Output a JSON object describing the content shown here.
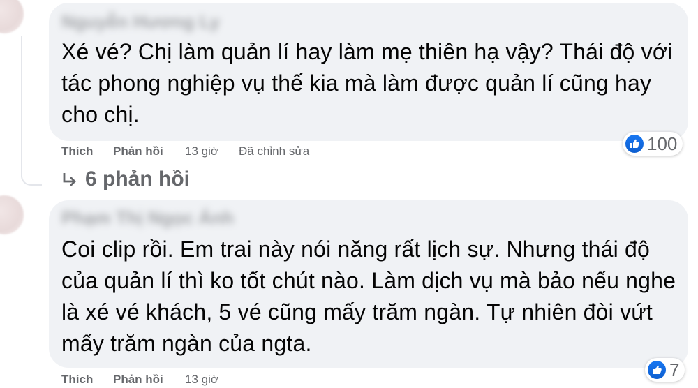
{
  "comments": [
    {
      "author": "Nguyễn Hương Ly",
      "text": "Xé vé? Chị làm quản lí hay làm mẹ thiên hạ vậy? Thái độ với tác phong nghiệp vụ thế kia mà làm được quản lí cũng hay cho chị.",
      "like_label": "Thích",
      "reply_label": "Phản hồi",
      "time": "13 giờ",
      "edited": "Đã chỉnh sửa",
      "reaction_icon": "like-icon",
      "reaction_count": "100",
      "replies_label": "6 phản hồi"
    },
    {
      "author": "Phạm Thị Ngọc Ánh",
      "text": "Coi clip rồi. Em trai này nói năng rất lịch sự. Nhưng thái độ của quản lí thì ko tốt chút nào. Làm dịch vụ mà bảo nếu nghe là xé vé khách, 5 vé cũng mấy trăm ngàn. Tự nhiên đòi vứt mấy trăm ngàn của ngta.",
      "like_label": "Thích",
      "reply_label": "Phản hồi",
      "time": "13 giờ",
      "reaction_icon": "like-icon",
      "reaction_count": "7"
    }
  ],
  "colors": {
    "bubble": "#f0f2f5",
    "secondary_text": "#65676b",
    "like_blue": "#1877f2"
  }
}
